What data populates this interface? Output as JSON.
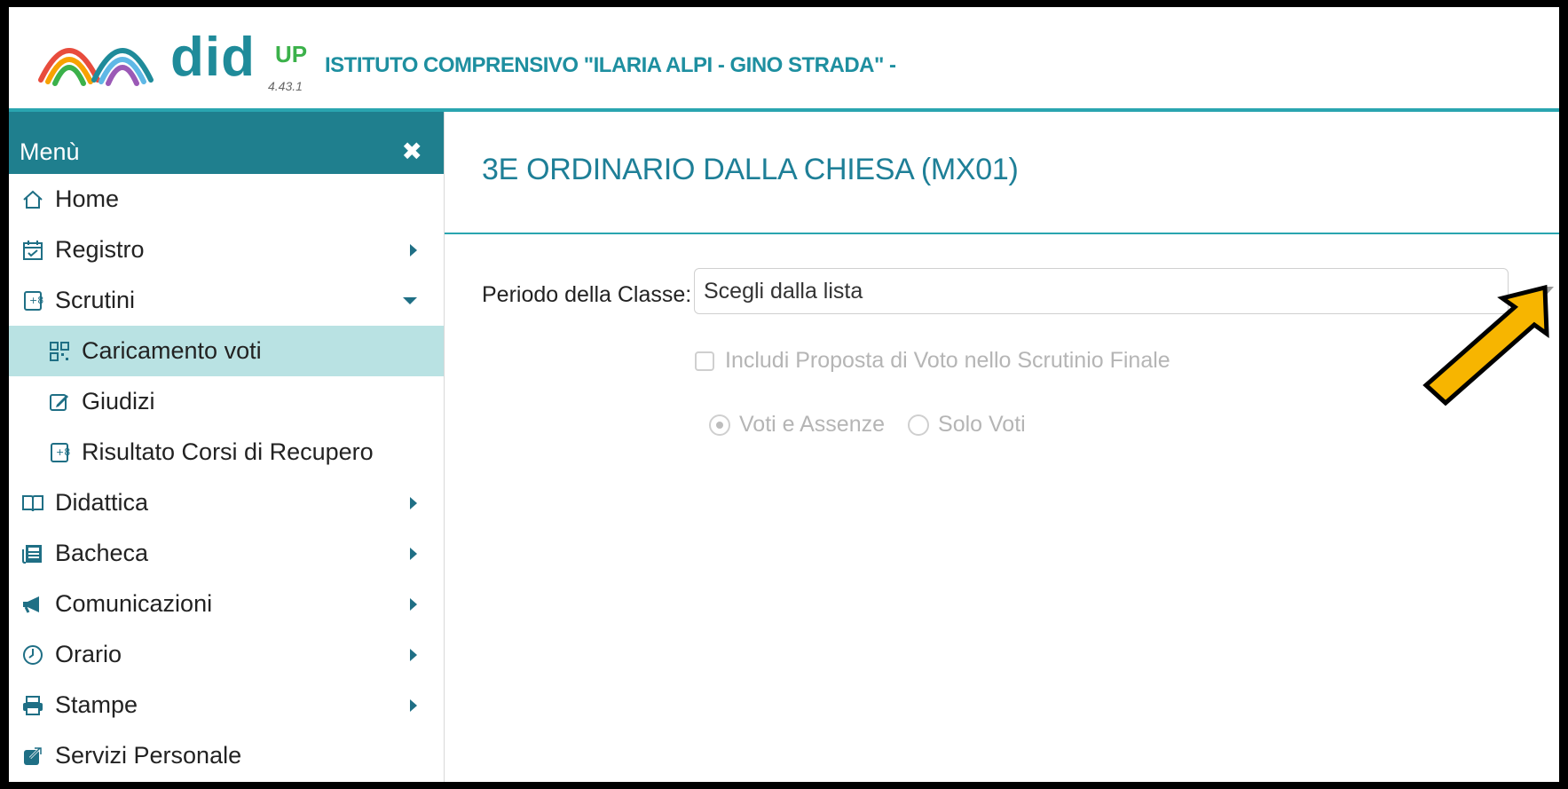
{
  "header": {
    "brand": "did",
    "brand_suffix": "UP",
    "version": "4.43.1",
    "school_name": "ISTITUTO COMPRENSIVO \"ILARIA ALPI - GINO STRADA\" -"
  },
  "sidebar": {
    "title": "Menù",
    "close_icon": "close-icon",
    "items": [
      {
        "label": "Home",
        "icon": "home-icon"
      },
      {
        "label": "Registro",
        "icon": "calendar-check-icon",
        "arrow": "right"
      },
      {
        "label": "Scrutini",
        "icon": "scrutini-icon",
        "arrow": "down"
      },
      {
        "label": "Caricamento voti",
        "icon": "qrcode-icon",
        "sub": true,
        "active": true
      },
      {
        "label": "Giudizi",
        "icon": "edit-icon",
        "sub": true
      },
      {
        "label": "Risultato Corsi di Recupero",
        "icon": "scrutini-icon",
        "sub": true
      },
      {
        "label": "Didattica",
        "icon": "book-icon",
        "arrow": "right"
      },
      {
        "label": "Bacheca",
        "icon": "newspaper-icon",
        "arrow": "right"
      },
      {
        "label": "Comunicazioni",
        "icon": "megaphone-icon",
        "arrow": "right"
      },
      {
        "label": "Orario",
        "icon": "clock-icon",
        "arrow": "right"
      },
      {
        "label": "Stampe",
        "icon": "printer-icon",
        "arrow": "right"
      },
      {
        "label": "Servizi Personale",
        "icon": "external-link-icon"
      }
    ]
  },
  "main": {
    "title": "3E ORDINARIO DALLA CHIESA (MX01)",
    "periodo_label": "Periodo della Classe:",
    "periodo_value": "Scegli dalla lista",
    "include_label": "Includi Proposta di Voto nello Scrutinio Finale",
    "radio_options": [
      {
        "label": "Voti e Assenze",
        "checked": true
      },
      {
        "label": "Solo Voti",
        "checked": false
      }
    ]
  },
  "colors": {
    "accent": "#1f7f8e",
    "active_bg": "#b9e2e3",
    "title": "#1e7f97",
    "annotation_arrow": "#f7b500"
  }
}
